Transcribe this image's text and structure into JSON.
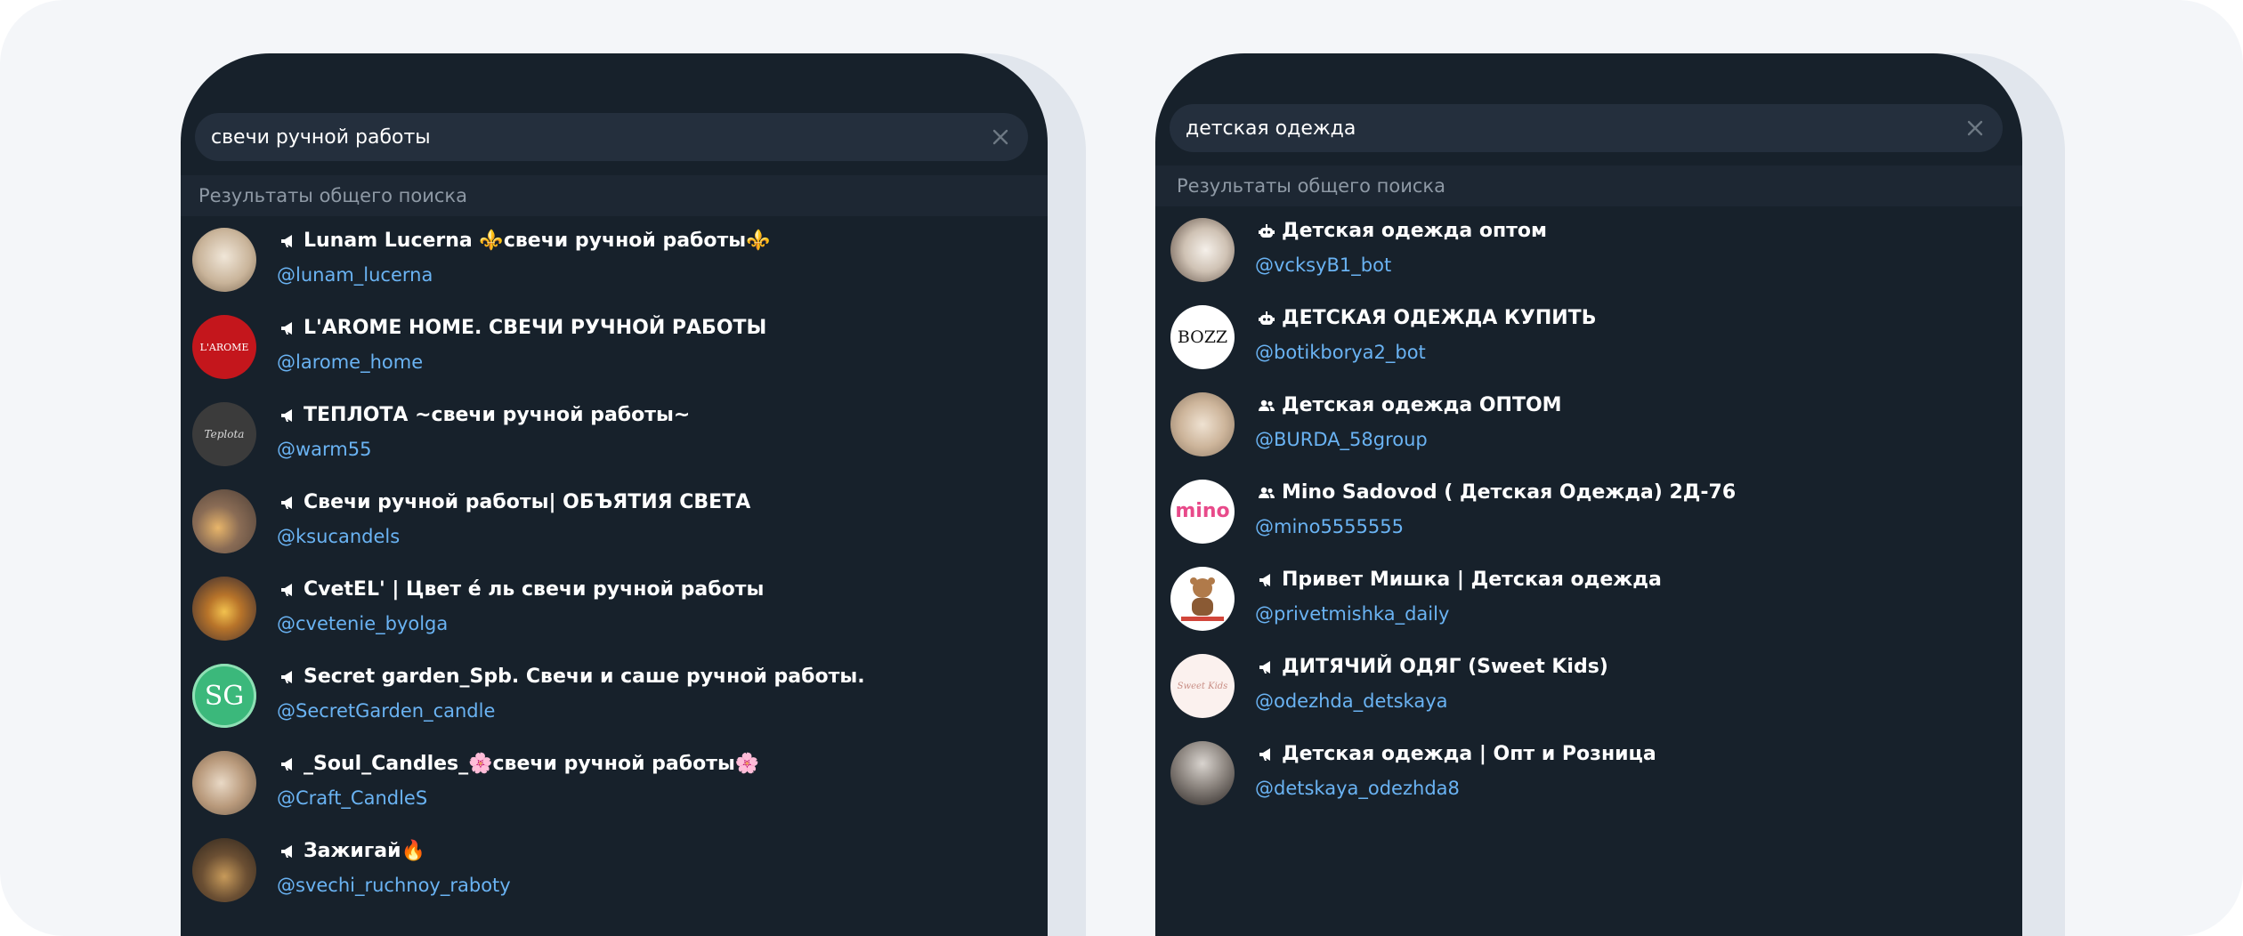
{
  "left": {
    "query": "свечи ручной работы",
    "section_title": "Результаты общего поиска",
    "results": [
      {
        "icon": "channel-icon",
        "name": "Lunam Lucerna ⚜️свечи ручной работы⚜️",
        "handle": "@lunam_lucerna"
      },
      {
        "icon": "channel-icon",
        "name": "L'AROME HOME. СВЕЧИ РУЧНОЙ РАБОТЫ",
        "handle": "@larome_home",
        "avatar_text": "L'AROME"
      },
      {
        "icon": "channel-icon",
        "name": "ТЕПЛОТА ~свечи ручной работы~",
        "handle": "@warm55",
        "avatar_text": "Teplota"
      },
      {
        "icon": "channel-icon",
        "name": "Свечи ручной работы| ОБЪЯТИЯ СВЕТА",
        "handle": "@ksucandels"
      },
      {
        "icon": "channel-icon",
        "name": "CvetEL' | Цвет é ль свечи ручной работы",
        "handle": "@cvetenie_byolga"
      },
      {
        "icon": "channel-icon",
        "name": "Secret garden_Spb. Свечи и саше ручной работы.",
        "handle": "@SecretGarden_candle",
        "avatar_text": "SG"
      },
      {
        "icon": "channel-icon",
        "name": "_Soul_Candles_🌸свечи ручной работы🌸",
        "handle": "@Craft_CandleS"
      },
      {
        "icon": "channel-icon",
        "name": "Зажигай🔥",
        "handle": "@svechi_ruchnoy_raboty"
      }
    ]
  },
  "right": {
    "query": "детская одежда",
    "section_title": "Результаты общего поиска",
    "results": [
      {
        "icon": "bot-icon",
        "name": "Детская одежда оптом",
        "handle": "@vcksyB1_bot"
      },
      {
        "icon": "bot-icon",
        "name": "ДЕТСКАЯ ОДЕЖДА КУПИТЬ",
        "handle": "@botikborya2_bot",
        "avatar_text": "BOZZ"
      },
      {
        "icon": "group-icon",
        "name": "Детская одежда ОПТОМ",
        "handle": "@BURDA_58group"
      },
      {
        "icon": "group-icon",
        "name": "Mino Sadovod ( Детская Одежда) 2Д-76",
        "handle": "@mino5555555",
        "avatar_text": "mino"
      },
      {
        "icon": "channel-icon",
        "name": "Привет Мишка | Детская одежда",
        "handle": "@privetmishka_daily"
      },
      {
        "icon": "channel-icon",
        "name": "ДИТЯЧИЙ ОДЯГ (Sweet Kids)",
        "handle": "@odezhda_detskaya",
        "avatar_text": "Sweet Kids"
      },
      {
        "icon": "channel-icon",
        "name": "Детская одежда | Опт и Розница",
        "handle": "@detskaya_odezhda8"
      }
    ]
  },
  "colors": {
    "panel_bg": "#17212b",
    "search_bg": "#242f3d",
    "section_bg": "#1d2733",
    "link": "#6ab3f3",
    "muted": "#8e99a5"
  }
}
